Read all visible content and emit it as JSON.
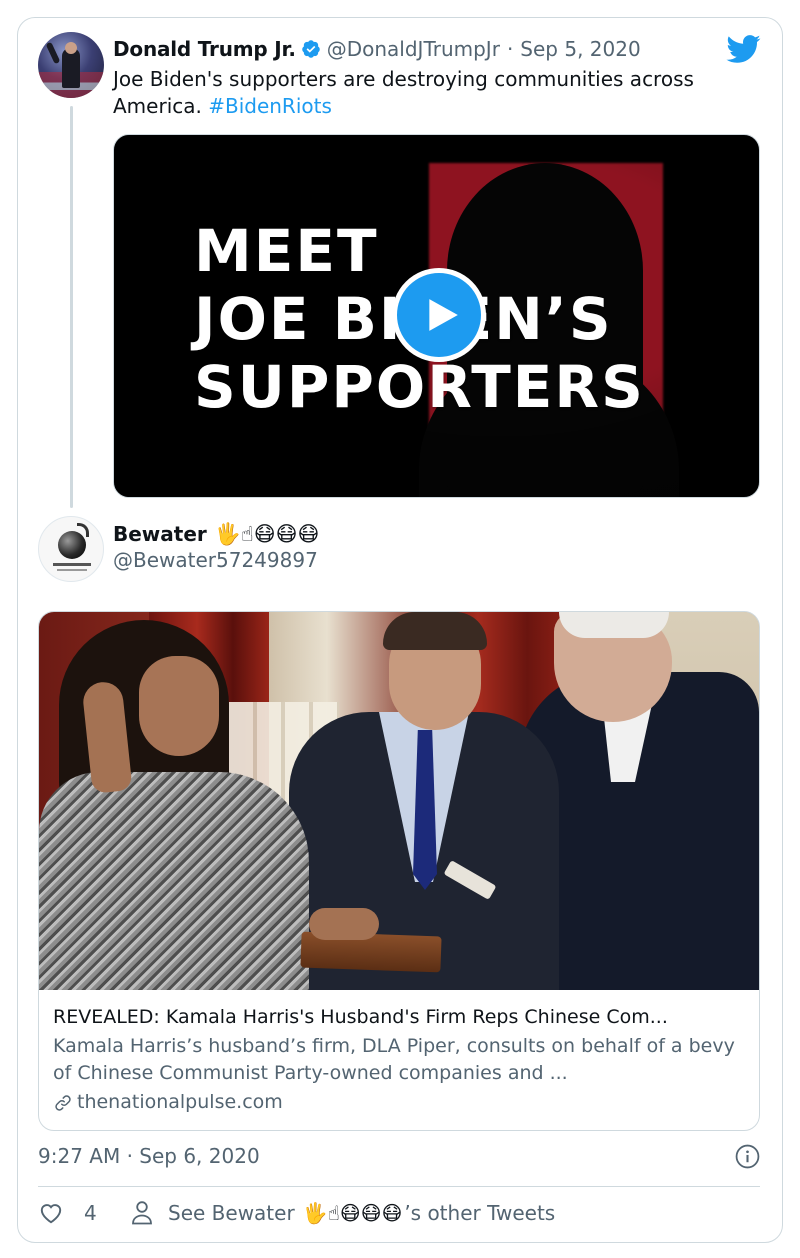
{
  "quoted_tweet": {
    "author_name": "Donald Trump Jr.",
    "handle": "@DonaldJTrumpJr",
    "separator": "·",
    "date": "Sep 5, 2020",
    "text": "Joe Biden's supporters are destroying communities across America.",
    "hashtag": "#BidenRiots",
    "video_title_lines": [
      "MEET",
      "JOE BIDEN’S",
      "SUPPORTERS"
    ]
  },
  "author": {
    "name": "Bewater",
    "name_emoji": "🖐☝😷😷😷",
    "handle": "@Bewater57249897"
  },
  "link_card": {
    "title": "REVEALED: Kamala Harris's Husband's Firm Reps Chinese Com...",
    "description": "Kamala Harris’s husband’s firm, DLA Piper, consults on behalf of a bevy of Chinese Communist Party-owned companies and ...",
    "domain": "thenationalpulse.com"
  },
  "footer": {
    "timestamp": "9:27 AM · Sep 6, 2020",
    "like_count": "4",
    "profile_link_prefix": "See Bewater",
    "profile_link_emoji": "🖐☝😷😷😷",
    "profile_link_suffix": "’s other Tweets"
  },
  "colors": {
    "accent": "#1d9bf0",
    "secondary_text": "#536471",
    "border": "#cfd9de"
  },
  "icons": [
    "verified-icon",
    "twitter-bird-icon",
    "play-icon",
    "link-icon",
    "info-icon",
    "heart-icon",
    "person-icon"
  ]
}
